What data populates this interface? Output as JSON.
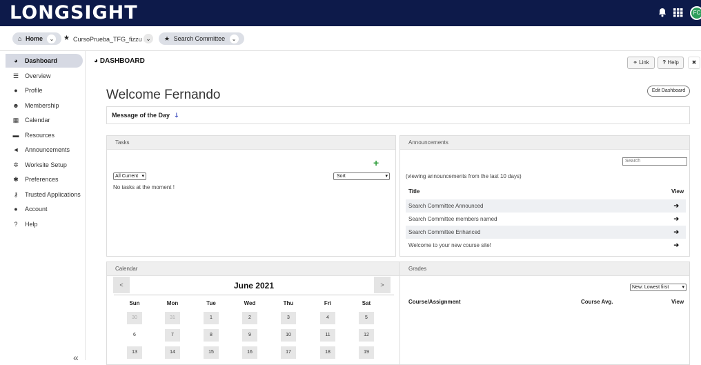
{
  "header": {
    "logo": "LONGSIGHT",
    "icons": [
      "bell-icon",
      "apps-grid-icon"
    ],
    "avatar_initials": "FC"
  },
  "breadcrumbs": {
    "home": "Home",
    "site": "CursoPrueba_TFG_fizzu ...",
    "committee": "Search Committee"
  },
  "sidebar": {
    "items": [
      {
        "label": "Dashboard",
        "icon": "dashboard-icon",
        "glyph": "◕",
        "active": true
      },
      {
        "label": "Overview",
        "icon": "list-icon",
        "glyph": "☰"
      },
      {
        "label": "Profile",
        "icon": "user-icon",
        "glyph": "●"
      },
      {
        "label": "Membership",
        "icon": "users-icon",
        "glyph": "☻"
      },
      {
        "label": "Calendar",
        "icon": "calendar-icon",
        "glyph": "▦"
      },
      {
        "label": "Resources",
        "icon": "folder-icon",
        "glyph": "▬"
      },
      {
        "label": "Announcements",
        "icon": "bullhorn-icon",
        "glyph": "◄"
      },
      {
        "label": "Worksite Setup",
        "icon": "cogs-icon",
        "glyph": "✲"
      },
      {
        "label": "Preferences",
        "icon": "gear-icon",
        "glyph": "✱"
      },
      {
        "label": "Trusted Applications",
        "icon": "key-icon",
        "glyph": "⚷"
      },
      {
        "label": "Account",
        "icon": "user-icon",
        "glyph": "●"
      },
      {
        "label": "Help",
        "icon": "question-circle-icon",
        "glyph": "?"
      }
    ],
    "collapse_glyph": "«"
  },
  "main": {
    "page_title": "DASHBOARD",
    "link_button": "Link",
    "help_button": "Help",
    "welcome": "Welcome Fernando",
    "edit_dashboard": "Edit Dashboard",
    "message_of_day": "Message of the Day"
  },
  "tasks": {
    "title": "Tasks",
    "filter_value": "All Current",
    "sort_value": "Sort",
    "empty_text": "No tasks at the moment !"
  },
  "announcements": {
    "title": "Announcements",
    "search_placeholder": "Search",
    "note": "(viewing announcements from the last 10 days)",
    "col_title": "Title",
    "col_view": "View",
    "rows": [
      {
        "title": "Search Committee Announced"
      },
      {
        "title": "Search Committee members named"
      },
      {
        "title": "Search Committee Enhanced"
      },
      {
        "title": "Welcome to your new course site!"
      }
    ]
  },
  "calendar": {
    "title": "Calendar",
    "month": "June 2021",
    "prev": "<",
    "next": ">",
    "days_of_week": [
      "Sun",
      "Mon",
      "Tue",
      "Wed",
      "Thu",
      "Fri",
      "Sat"
    ],
    "weeks": [
      [
        "30",
        "31",
        "1",
        "2",
        "3",
        "4",
        "5"
      ],
      [
        "6",
        "7",
        "8",
        "9",
        "10",
        "11",
        "12"
      ],
      [
        "13",
        "14",
        "15",
        "16",
        "17",
        "18",
        "19"
      ]
    ]
  },
  "grades": {
    "title": "Grades",
    "sort_value": "New: Lowest first",
    "col_course": "Course/Assignment",
    "col_avg": "Course Avg.",
    "col_view": "View"
  },
  "colors": {
    "topbar": "#0d1a4a",
    "accent": "#2a3bb8",
    "add": "#2e9e3b"
  }
}
